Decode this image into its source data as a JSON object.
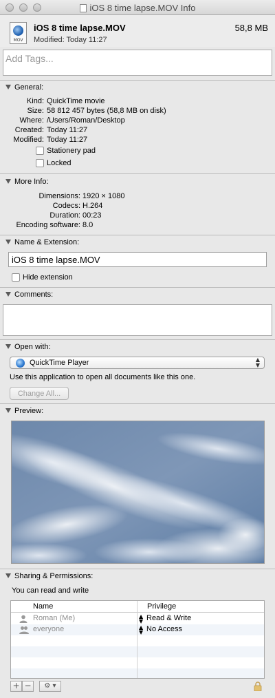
{
  "window": {
    "title": "iOS 8 time lapse.MOV Info"
  },
  "header": {
    "file_name": "iOS 8 time lapse.MOV",
    "modified": "Modified: Today 11:27",
    "size": "58,8 MB",
    "icon_ext": "MOV"
  },
  "tags": {
    "placeholder": "Add Tags..."
  },
  "general": {
    "heading": "General:",
    "fields": [
      {
        "label": "Kind:",
        "value": "QuickTime movie"
      },
      {
        "label": "Size:",
        "value": "58 812 457 bytes (58,8 MB on disk)"
      },
      {
        "label": "Where:",
        "value": "/Users/Roman/Desktop"
      },
      {
        "label": "Created:",
        "value": "Today 11:27"
      },
      {
        "label": "Modified:",
        "value": "Today 11:27"
      }
    ],
    "stationery_label": "Stationery pad",
    "stationery_checked": false,
    "locked_label": "Locked",
    "locked_checked": false
  },
  "more_info": {
    "heading": "More Info:",
    "fields": [
      {
        "label": "Dimensions:",
        "value": "1920 × 1080"
      },
      {
        "label": "Codecs:",
        "value": "H.264"
      },
      {
        "label": "Duration:",
        "value": "00:23"
      },
      {
        "label": "Encoding software:",
        "value": "8.0"
      }
    ]
  },
  "name_extension": {
    "heading": "Name & Extension:",
    "value": "iOS 8 time lapse.MOV",
    "hide_extension_label": "Hide extension",
    "hide_extension_checked": false
  },
  "comments": {
    "heading": "Comments:",
    "value": ""
  },
  "open_with": {
    "heading": "Open with:",
    "app": "QuickTime Player",
    "description": "Use this application to open all documents like this one.",
    "change_all_label": "Change All..."
  },
  "preview": {
    "heading": "Preview:"
  },
  "sharing": {
    "heading": "Sharing & Permissions:",
    "summary": "You can read and write",
    "columns": [
      "Name",
      "Privilege"
    ],
    "rows": [
      {
        "name": "Roman (Me)",
        "privilege": "Read & Write"
      },
      {
        "name": "everyone",
        "privilege": "No Access"
      }
    ]
  },
  "toolbar": {
    "add": "+",
    "remove": "−",
    "action": "⚙ ▾"
  }
}
